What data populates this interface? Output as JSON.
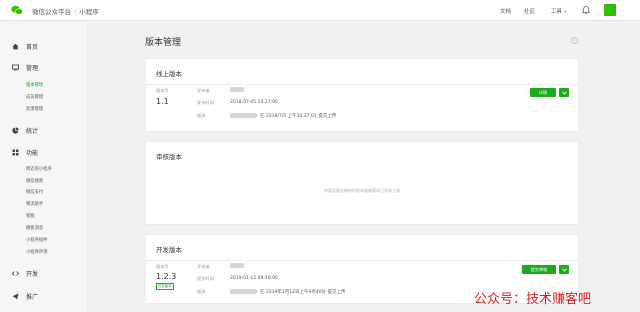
{
  "header": {
    "brand": "微信公众平台",
    "product": "小程序",
    "links": {
      "docs": "文档",
      "community": "社区",
      "tools": "工具"
    }
  },
  "sidebar": {
    "home": "首页",
    "manage": "管理",
    "manage_items": [
      "版本管理",
      "成员管理",
      "反馈管理"
    ],
    "stats": "统计",
    "features": "功能",
    "feature_items": [
      "附近的小程序",
      "微信搜索",
      "微信支付",
      "物流助手",
      "客服",
      "模板消息",
      "小程序插件",
      "小程序评测"
    ],
    "dev": "开发",
    "promo": "推广",
    "active_item": "版本管理"
  },
  "page": {
    "title": "版本管理"
  },
  "online": {
    "title": "线上版本",
    "version_label": "版本号",
    "version": "1.1",
    "publisher_label": "发布者",
    "time_label": "发布时间",
    "time": "2018-07-05 14:27:00",
    "desc_label": "描述",
    "desc": "在 2018/7/5 上午10:27:01 提交上传",
    "detail_button": "详情"
  },
  "review": {
    "title": "审核版本",
    "empty": "你暂无提交审核的版本或者版本已发布上线"
  },
  "dev": {
    "title": "开发版本",
    "version_label": "版本号",
    "version": "1.2.3",
    "badge": "开发版本",
    "developer_label": "开发者",
    "time_label": "提交时间",
    "time": "2019-01-12 09:40:00",
    "desc_label": "描述",
    "desc": "在 2019年1月12日上午9点40分 提交上传",
    "submit_button": "提交审核"
  },
  "watermark": "公众号：技术赚客吧",
  "colors": {
    "accent": "#1aad19",
    "watermark": "#e31b1b"
  }
}
